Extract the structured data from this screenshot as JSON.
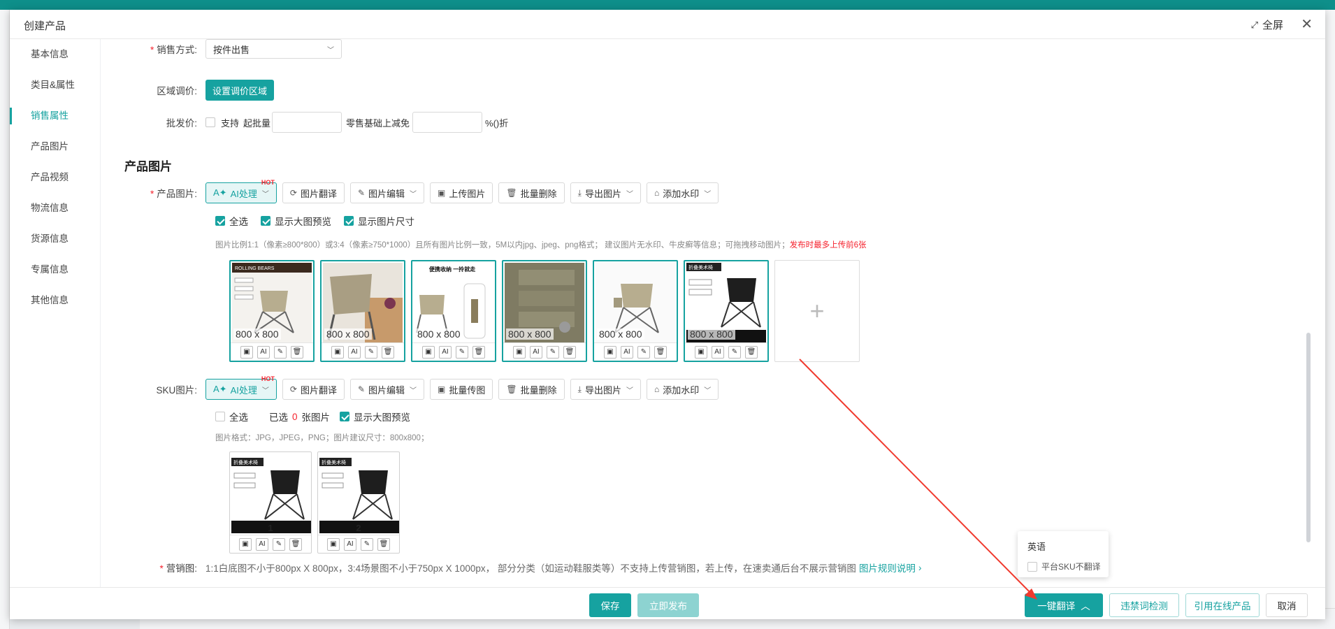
{
  "dialog": {
    "title": "创建产品",
    "fullscreen": "全屏",
    "close": "✕"
  },
  "nav": [
    {
      "label": "基本信息"
    },
    {
      "label": "类目&属性"
    },
    {
      "label": "销售属性"
    },
    {
      "label": "产品图片"
    },
    {
      "label": "产品视频"
    },
    {
      "label": "物流信息"
    },
    {
      "label": "货源信息"
    },
    {
      "label": "专属信息"
    },
    {
      "label": "其他信息"
    }
  ],
  "active_nav": "销售属性",
  "sales": {
    "method_label": "销售方式:",
    "method_value": "按件出售",
    "region_label": "区域调价:",
    "region_button": "设置调价区域",
    "wholesale_label": "批发价:",
    "wholesale_support": "支持",
    "wholesale_min": "起批量",
    "wholesale_reduce": "零售基础上减免",
    "wholesale_unit": "%()折"
  },
  "product_images": {
    "section_title": "产品图片",
    "label": "产品图片:",
    "toolbar": [
      "AI处理",
      "图片翻译",
      "图片编辑",
      "上传图片",
      "批量删除",
      "导出图片",
      "添加水印"
    ],
    "hot": "HOT",
    "checks": [
      "全选",
      "显示大图预览",
      "显示图片尺寸"
    ],
    "hint": "图片比例1:1（像素≥800*800）或3:4（像素≥750*1000）且所有图片比例一致，5M以内jpg、jpeg、png格式；  建议图片无水印、牛皮癣等信息；可拖拽移动图片；",
    "hint_red": "发布时最多上传前6张",
    "sizes": [
      "800 x 800",
      "800 x 800",
      "800 x 800",
      "800 x 800",
      "800 x 800",
      "800 x 800"
    ],
    "thumb_texts": [
      "ROLLING BEARS",
      "",
      "便携收纳 一拎就走",
      "",
      "",
      "折叠美术椅"
    ]
  },
  "sku_images": {
    "label": "SKU图片:",
    "toolbar": [
      "AI处理",
      "图片翻译",
      "图片编辑",
      "批量传图",
      "批量删除",
      "导出图片",
      "添加水印"
    ],
    "check_all": "全选",
    "selected_prefix": "已选",
    "selected_count": "0",
    "selected_suffix": "张图片",
    "preview": "显示大图预览",
    "hint": "图片格式：JPG，JPEG，PNG；图片建议尺寸：800x800；",
    "numbers": [
      "1",
      "2"
    ],
    "banner": "折叠美术椅"
  },
  "marketing": {
    "label": "营销图:",
    "text": "1:1白底图不小于800px X 800px，3:4场景图不小于750px X 1000px， 部分分类（如运动鞋服类等）不支持上传营销图，若上传，在速卖通后台不展示营销图",
    "link": "图片规则说明"
  },
  "footer": {
    "save": "保存",
    "publish": "立即发布",
    "translate": "一键翻译",
    "banned": "违禁词检测",
    "reference": "引用在线产品",
    "cancel": "取消"
  },
  "popover": {
    "language": "英语",
    "option": "平台SKU不翻译"
  },
  "colors": {
    "accent": "#16a2a0",
    "red": "#f5222d"
  }
}
